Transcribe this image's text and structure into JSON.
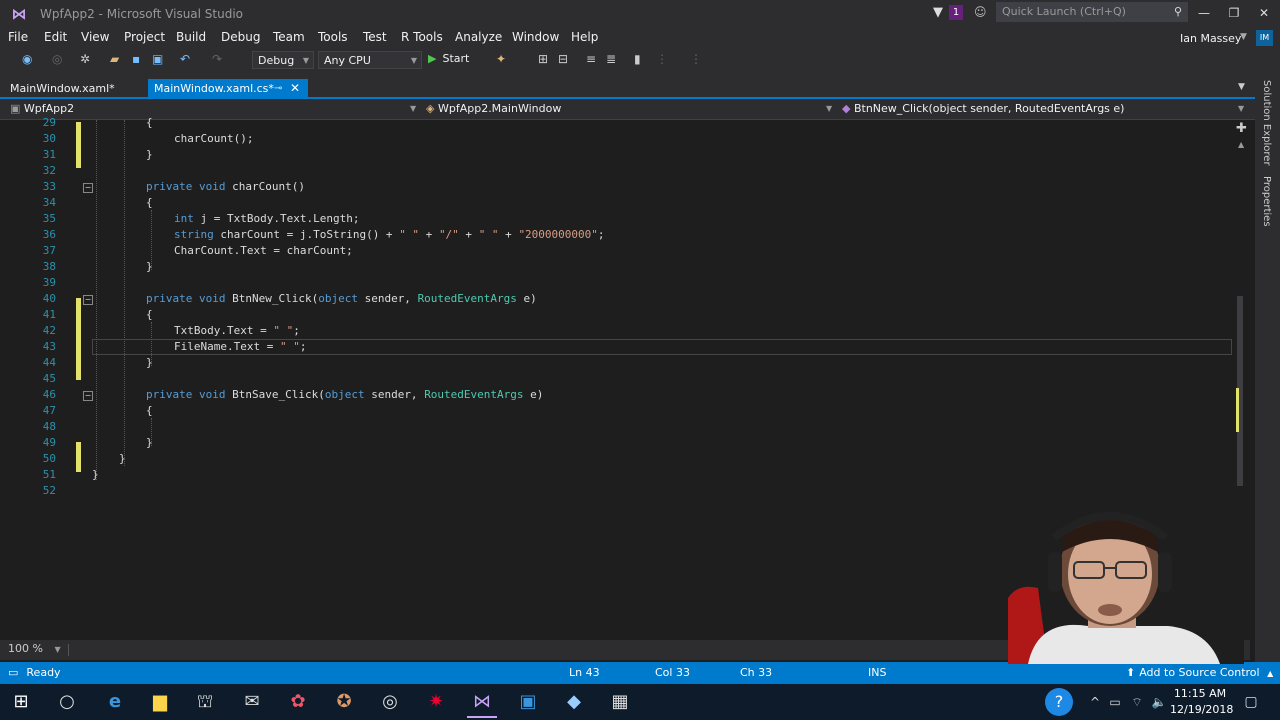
{
  "window": {
    "title": "WpfApp2 - Microsoft Visual Studio",
    "notifications": "1",
    "quick_launch_placeholder": "Quick Launch (Ctrl+Q)",
    "minimize": "—",
    "restore": "❐",
    "close": "✕"
  },
  "menu": [
    "File",
    "Edit",
    "View",
    "Project",
    "Build",
    "Debug",
    "Team",
    "Tools",
    "Test",
    "R Tools",
    "Analyze",
    "Window",
    "Help"
  ],
  "user": {
    "name": "Ian Massey",
    "initials": "IM"
  },
  "toolbar": {
    "configuration": "Debug",
    "platform": "Any CPU",
    "start": "Start"
  },
  "tabs": [
    {
      "label": "MainWindow.xaml*",
      "active": false
    },
    {
      "label": "MainWindow.xaml.cs*",
      "active": true
    }
  ],
  "navbar": {
    "project": "WpfApp2",
    "class": "WpfApp2.MainWindow",
    "member": "BtnNew_Click(object sender, RoutedEventArgs e)"
  },
  "editor": {
    "lines": [
      {
        "n": "29",
        "html": "{"
      },
      {
        "n": "30",
        "html": "charCount();"
      },
      {
        "n": "31",
        "html": "}"
      },
      {
        "n": "32",
        "html": ""
      },
      {
        "n": "33",
        "html": "private void charCount()"
      },
      {
        "n": "34",
        "html": "{"
      },
      {
        "n": "35",
        "html": "int j = TxtBody.Text.Length;"
      },
      {
        "n": "36",
        "html": "string charCount = j.ToString() + \" \" + \"/\" + \" \" + \"2000000000\";"
      },
      {
        "n": "37",
        "html": "CharCount.Text = charCount;"
      },
      {
        "n": "38",
        "html": "}"
      },
      {
        "n": "39",
        "html": ""
      },
      {
        "n": "40",
        "html": "private void BtnNew_Click(object sender, RoutedEventArgs e)"
      },
      {
        "n": "41",
        "html": "{"
      },
      {
        "n": "42",
        "html": "TxtBody.Text = \" \";"
      },
      {
        "n": "43",
        "html": "FileName.Text = \" \";"
      },
      {
        "n": "44",
        "html": "}"
      },
      {
        "n": "45",
        "html": ""
      },
      {
        "n": "46",
        "html": "private void BtnSave_Click(object sender, RoutedEventArgs e)"
      },
      {
        "n": "47",
        "html": "{"
      },
      {
        "n": "48",
        "html": ""
      },
      {
        "n": "49",
        "html": "}"
      },
      {
        "n": "50",
        "html": "}"
      },
      {
        "n": "51",
        "html": "}"
      },
      {
        "n": "52",
        "html": ""
      }
    ]
  },
  "zoom": "100 %",
  "status": {
    "state": "Ready",
    "ln": "Ln 43",
    "col": "Col 33",
    "ch": "Ch 33",
    "mode": "INS",
    "source_control": "Add to Source Control"
  },
  "side_panels": [
    "Solution Explorer",
    "Properties"
  ],
  "taskbar": {
    "time": "11:15 AM",
    "date": "12/19/2018"
  },
  "colors": {
    "accent": "#007acc",
    "keyword": "#569cd6",
    "type": "#4ec9b0",
    "string": "#d69d85",
    "line_number": "#2b91af"
  }
}
